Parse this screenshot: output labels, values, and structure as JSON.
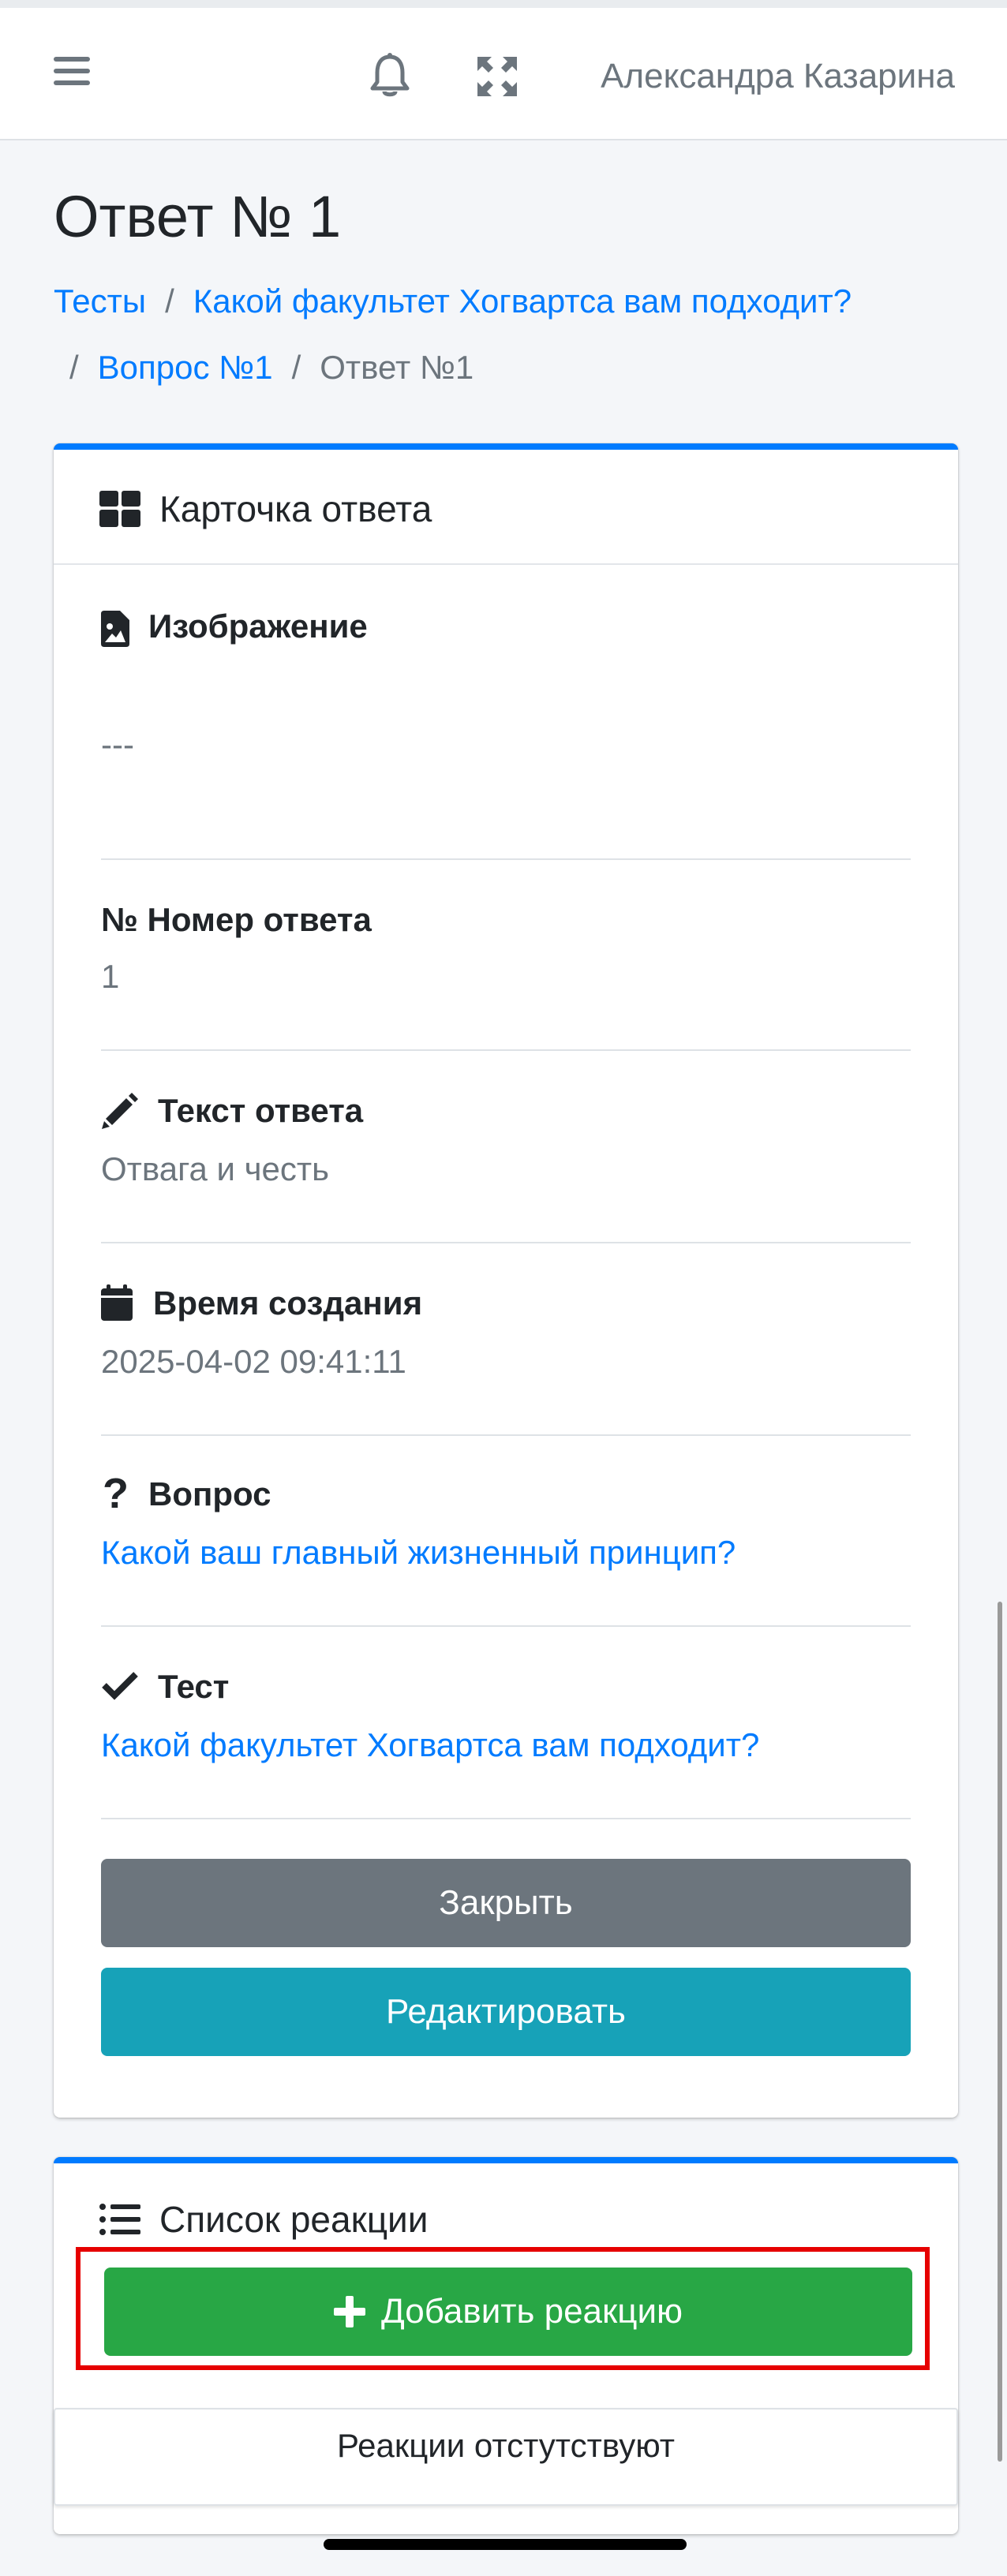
{
  "navbar": {
    "user_name": "Александра Казарина"
  },
  "header": {
    "title": "Ответ № 1",
    "breadcrumb": {
      "item1": "Тесты",
      "item2": "Какой факультет Хогвартса вам подходит?",
      "item3": "Вопрос №1",
      "current": "Ответ №1"
    }
  },
  "answer_card": {
    "title": "Карточка ответа",
    "image": {
      "label": "Изображение",
      "value": "---"
    },
    "number": {
      "label": "№ Номер ответа",
      "value": "1"
    },
    "text": {
      "label": "Текст ответа",
      "value": "Отвага и честь"
    },
    "created": {
      "label": "Время создания",
      "value": "2025-04-02 09:41:11"
    },
    "question": {
      "label": "Вопрос",
      "value": "Какой ваш главный жизненный принцип?"
    },
    "test": {
      "label": "Тест",
      "value": "Какой факультет Хогвартса вам подходит?"
    },
    "close_label": "Закрыть",
    "edit_label": "Редактировать"
  },
  "reactions_card": {
    "title": "Список реакции",
    "add_label": "Добавить реакцию",
    "empty_text": "Реакции отстутствуют"
  },
  "colors": {
    "primary": "#007bff",
    "secondary": "#6c757d",
    "info": "#17a2b8",
    "success": "#28a745",
    "highlight": "#e60000"
  }
}
